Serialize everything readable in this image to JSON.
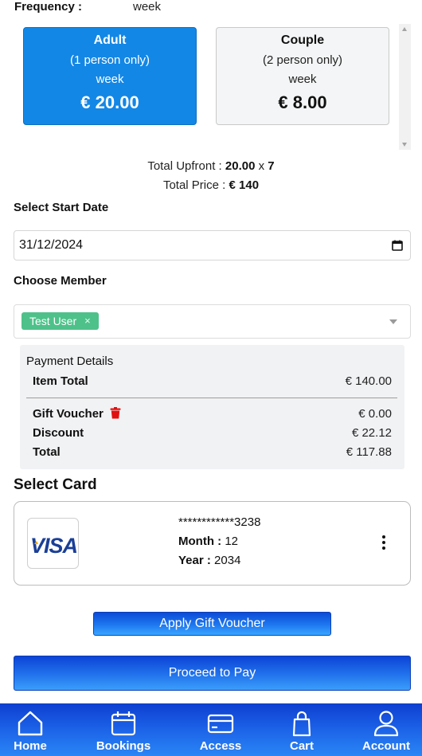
{
  "frequency": {
    "label": "Frequency :",
    "value": "week"
  },
  "plans": [
    {
      "name": "Adult",
      "subtitle": "(1 person only)",
      "period": "week",
      "price": "€ 20.00",
      "selected": true
    },
    {
      "name": "Couple",
      "subtitle": "(2 person only)",
      "period": "week",
      "price": "€ 8.00",
      "selected": false
    }
  ],
  "totals": {
    "upfront_label": "Total Upfront :",
    "upfront_amount": "20.00",
    "upfront_times": "x",
    "upfront_count": "7",
    "price_label": "Total Price :",
    "price_amount": "€ 140"
  },
  "start_date": {
    "label": "Select Start Date",
    "value": "31/12/2024"
  },
  "member": {
    "label": "Choose Member",
    "selected_tag": "Test User",
    "remove_symbol": "×"
  },
  "payment": {
    "title": "Payment Details",
    "item_total_label": "Item Total",
    "item_total_value": "€ 140.00",
    "gift_voucher_label": "Gift Voucher",
    "gift_voucher_value": "€ 0.00",
    "discount_label": "Discount",
    "discount_value": "€ 22.12",
    "total_label": "Total",
    "total_value": "€ 117.88"
  },
  "card": {
    "section_title": "Select Card",
    "brand": "VISA",
    "masked_number": "************3238",
    "month_label": "Month :",
    "month_value": "12",
    "year_label": "Year :",
    "year_value": "2034"
  },
  "buttons": {
    "apply_voucher": "Apply Gift Voucher",
    "proceed": "Proceed to Pay"
  },
  "nav": [
    {
      "label": "Home",
      "icon": "home-icon"
    },
    {
      "label": "Bookings",
      "icon": "calendar-icon"
    },
    {
      "label": "Access",
      "icon": "card-icon"
    },
    {
      "label": "Cart",
      "icon": "bag-icon"
    },
    {
      "label": "Account",
      "icon": "user-icon"
    }
  ],
  "colors": {
    "selected_plan": "#1387e6",
    "tag_green": "#4ec18a",
    "button_blue": "#1e6fea",
    "trash_red": "#e01010",
    "visa_blue": "#1a3f96",
    "visa_gold": "#f2a900"
  }
}
